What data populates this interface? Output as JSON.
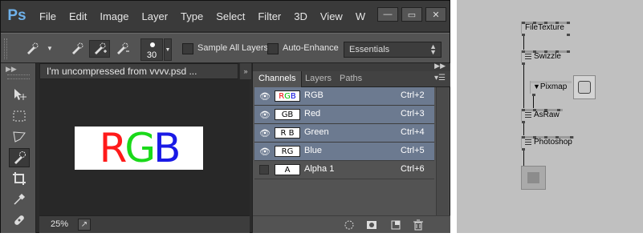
{
  "menubar": {
    "logo": "Ps",
    "items": [
      "File",
      "Edit",
      "Image",
      "Layer",
      "Type",
      "Select",
      "Filter",
      "3D",
      "View",
      "W"
    ],
    "controls": [
      "—",
      "▭",
      "✕"
    ]
  },
  "optionsbar": {
    "brush_size": "30",
    "sample_all_layers_label": "Sample All Layers",
    "auto_enhance_label": "Auto-Enhance",
    "workspace": "Essentials"
  },
  "document": {
    "tab_title": "I'm uncompressed from vvvv.psd ...",
    "panel_toggle": "»",
    "canvas_text": [
      "R",
      "G",
      "B"
    ],
    "zoom": "25%"
  },
  "colors": {
    "red": "#ff1a1a",
    "green": "#1ad91a",
    "blue": "#1a1ae6",
    "selection": "#6c7a90"
  },
  "channels_panel": {
    "tabs": [
      "Channels",
      "Layers",
      "Paths"
    ],
    "channels": [
      {
        "thumb": "RGB",
        "name": "RGB",
        "shortcut": "Ctrl+2",
        "visible": true
      },
      {
        "thumb": "GB",
        "name": "Red",
        "shortcut": "Ctrl+3",
        "visible": true
      },
      {
        "thumb": "R B",
        "name": "Green",
        "shortcut": "Ctrl+4",
        "visible": true
      },
      {
        "thumb": "RG",
        "name": "Blue",
        "shortcut": "Ctrl+5",
        "visible": true
      },
      {
        "thumb": "A",
        "name": "Alpha 1",
        "shortcut": "Ctrl+6",
        "visible": false
      }
    ]
  },
  "patch": {
    "nodes": [
      "FileTexture",
      "Swizzle",
      "Pixmap",
      "AsRaw",
      "Photoshop"
    ]
  }
}
